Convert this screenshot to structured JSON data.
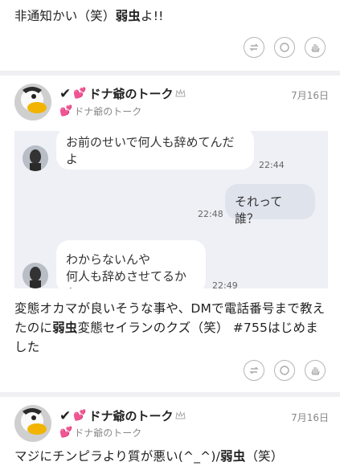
{
  "post1": {
    "text_before": "非通知かい（笑）",
    "text_bold": "弱虫",
    "text_after": "よ!!"
  },
  "post2": {
    "user_name": "ドナ爺のトーク",
    "handle": "ドナ爺のトーク",
    "date": "7月16日",
    "chat": {
      "msg1": "お前のせいで何人も辞めてんだよ",
      "time1": "22:44",
      "msg2": "それって誰？",
      "time2": "22:48",
      "msg3_line1": "わからないんや",
      "msg3_line2": "何人も辞めさせてるから",
      "time3": "22:49"
    },
    "text_part1": "変態オカマが良いそうな事や、DMで電話番号まで教えたのに",
    "text_bold": "弱虫",
    "text_part2": "変態セイランのクズ（笑） #755はじめました"
  },
  "post3": {
    "user_name": "ドナ爺のトーク",
    "handle": "ドナ爺のトーク",
    "date": "7月16日",
    "text_before": "マジにチンピラより質が悪い(^_^)/",
    "text_bold": "弱虫",
    "text_after": "（笑）"
  },
  "icons": [
    "repost-icon",
    "comment-icon",
    "hand-wave-icon"
  ],
  "colors": {
    "heart": "#e040a0",
    "separator": "#f0f0f2",
    "chat_bg": "#eef0f5"
  }
}
